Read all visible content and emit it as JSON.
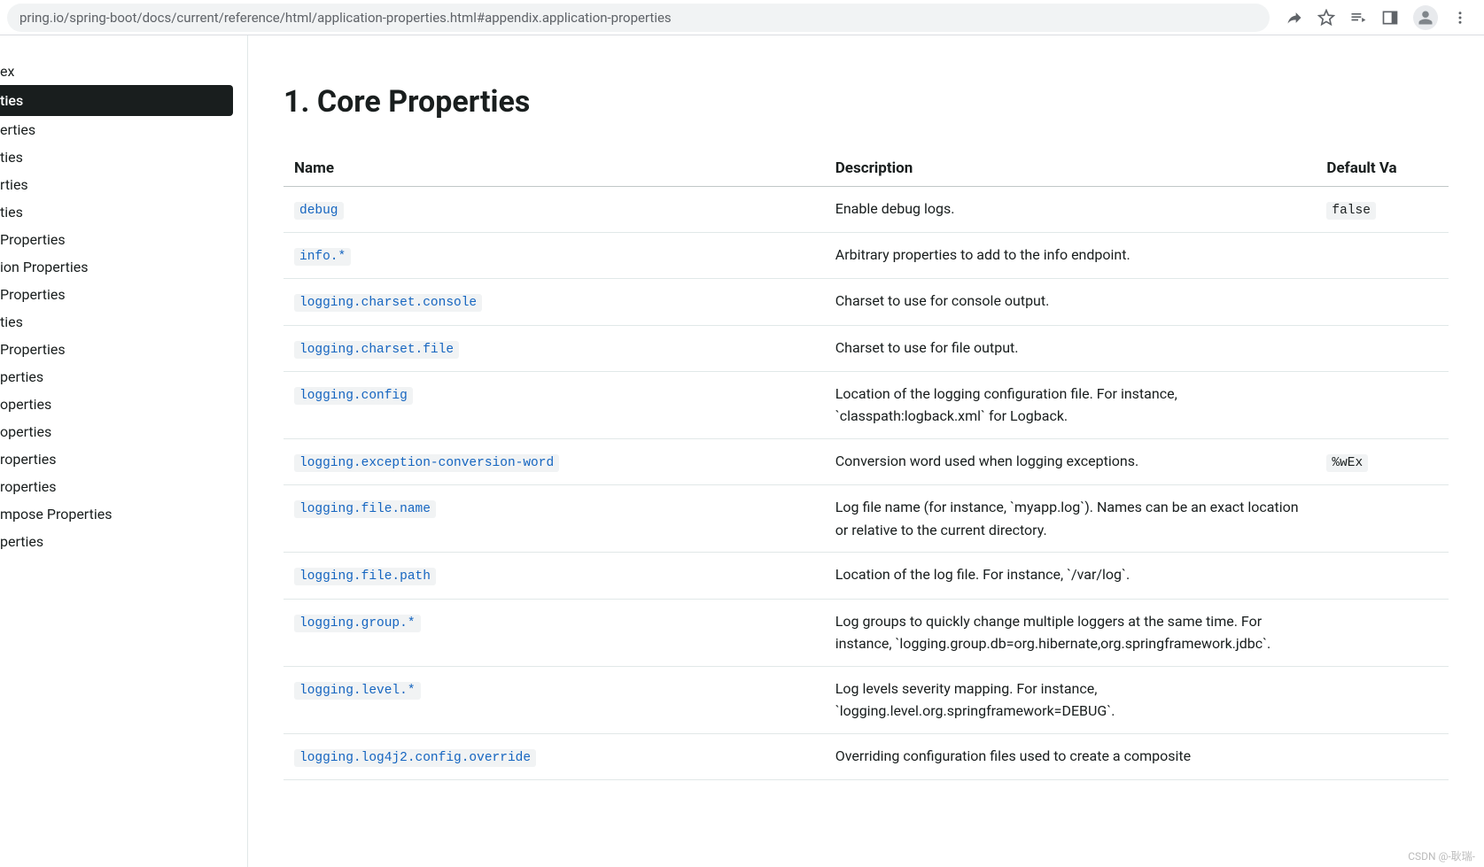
{
  "url": "pring.io/spring-boot/docs/current/reference/html/application-properties.html#appendix.application-properties",
  "sidebar": {
    "items": [
      "ex",
      "ties",
      "erties",
      "ties",
      "rties",
      "ties",
      "Properties",
      "ion Properties",
      "Properties",
      "ties",
      " Properties",
      "perties",
      "operties",
      "operties",
      "roperties",
      "roperties",
      "mpose Properties",
      "perties"
    ],
    "active_index": 1
  },
  "main": {
    "title": "1. Core Properties",
    "headers": {
      "name": "Name",
      "description": "Description",
      "default": "Default Va"
    },
    "rows": [
      {
        "name": "debug",
        "desc": "Enable debug logs.",
        "def": "false"
      },
      {
        "name": "info.*",
        "desc": "Arbitrary properties to add to the info endpoint.",
        "def": ""
      },
      {
        "name": "logging.charset.console",
        "desc": "Charset to use for console output.",
        "def": ""
      },
      {
        "name": "logging.charset.file",
        "desc": "Charset to use for file output.",
        "def": ""
      },
      {
        "name": "logging.config",
        "desc": "Location of the logging configuration file. For instance, `classpath:logback.xml` for Logback.",
        "def": ""
      },
      {
        "name": "logging.exception-conversion-word",
        "desc": "Conversion word used when logging exceptions.",
        "def": "%wEx"
      },
      {
        "name": "logging.file.name",
        "desc": "Log file name (for instance, `myapp.log`). Names can be an exact location or relative to the current directory.",
        "def": ""
      },
      {
        "name": "logging.file.path",
        "desc": "Location of the log file. For instance, `/var/log`.",
        "def": ""
      },
      {
        "name": "logging.group.*",
        "desc": "Log groups to quickly change multiple loggers at the same time. For instance, `logging.group.db=org.hibernate,org.springframework.jdbc`.",
        "def": ""
      },
      {
        "name": "logging.level.*",
        "desc": "Log levels severity mapping. For instance, `logging.level.org.springframework=DEBUG`.",
        "def": ""
      },
      {
        "name": "logging.log4j2.config.override",
        "desc": "Overriding configuration files used to create a composite",
        "def": ""
      }
    ]
  },
  "watermark": "CSDN @-耿瑞-"
}
